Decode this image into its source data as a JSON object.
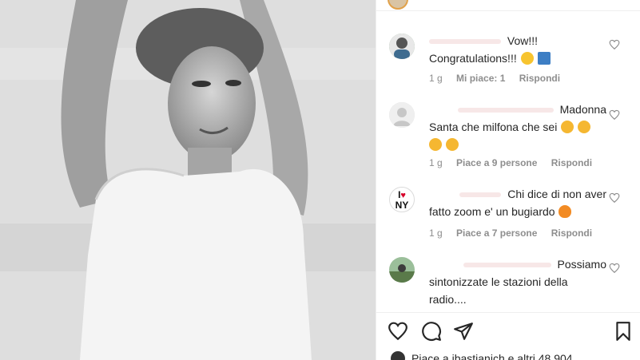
{
  "post": {
    "comments": [
      {
        "text_line1": "Vow!!!",
        "text_line2": "Congratulations!!!",
        "age": "1 g",
        "likes": "Mi piace: 1",
        "reply": "Rispondi"
      },
      {
        "text_line1": "Madonna",
        "text_line2": "Santa che milfona che sei",
        "age": "1 g",
        "likes": "Piace a 9 persone",
        "reply": "Rispondi"
      },
      {
        "text_line1": "Chi dice di non aver",
        "text_line2": "fatto zoom e' un bugiardo",
        "age": "1 g",
        "likes": "Piace a 7 persone",
        "reply": "Rispondi"
      },
      {
        "text_line1": "Possiamo",
        "text_line2": "sintonizzate le stazioni della",
        "text_line3": "radio....",
        "avatar_text": ""
      }
    ],
    "likes_summary": "Piace a ibastianich e altri 48.904"
  },
  "avatars": {
    "comment3_label_top": "I",
    "comment3_label_bottom": "NY"
  },
  "icons": {
    "like_icon": "heart-outline-icon",
    "comment_icon": "comment-bubble-icon",
    "share_icon": "paper-plane-icon",
    "save_icon": "bookmark-icon"
  },
  "colors": {
    "text": "#262626",
    "meta": "#8e8e8e",
    "border": "#efefef",
    "story_ring": "#e1a14a"
  }
}
